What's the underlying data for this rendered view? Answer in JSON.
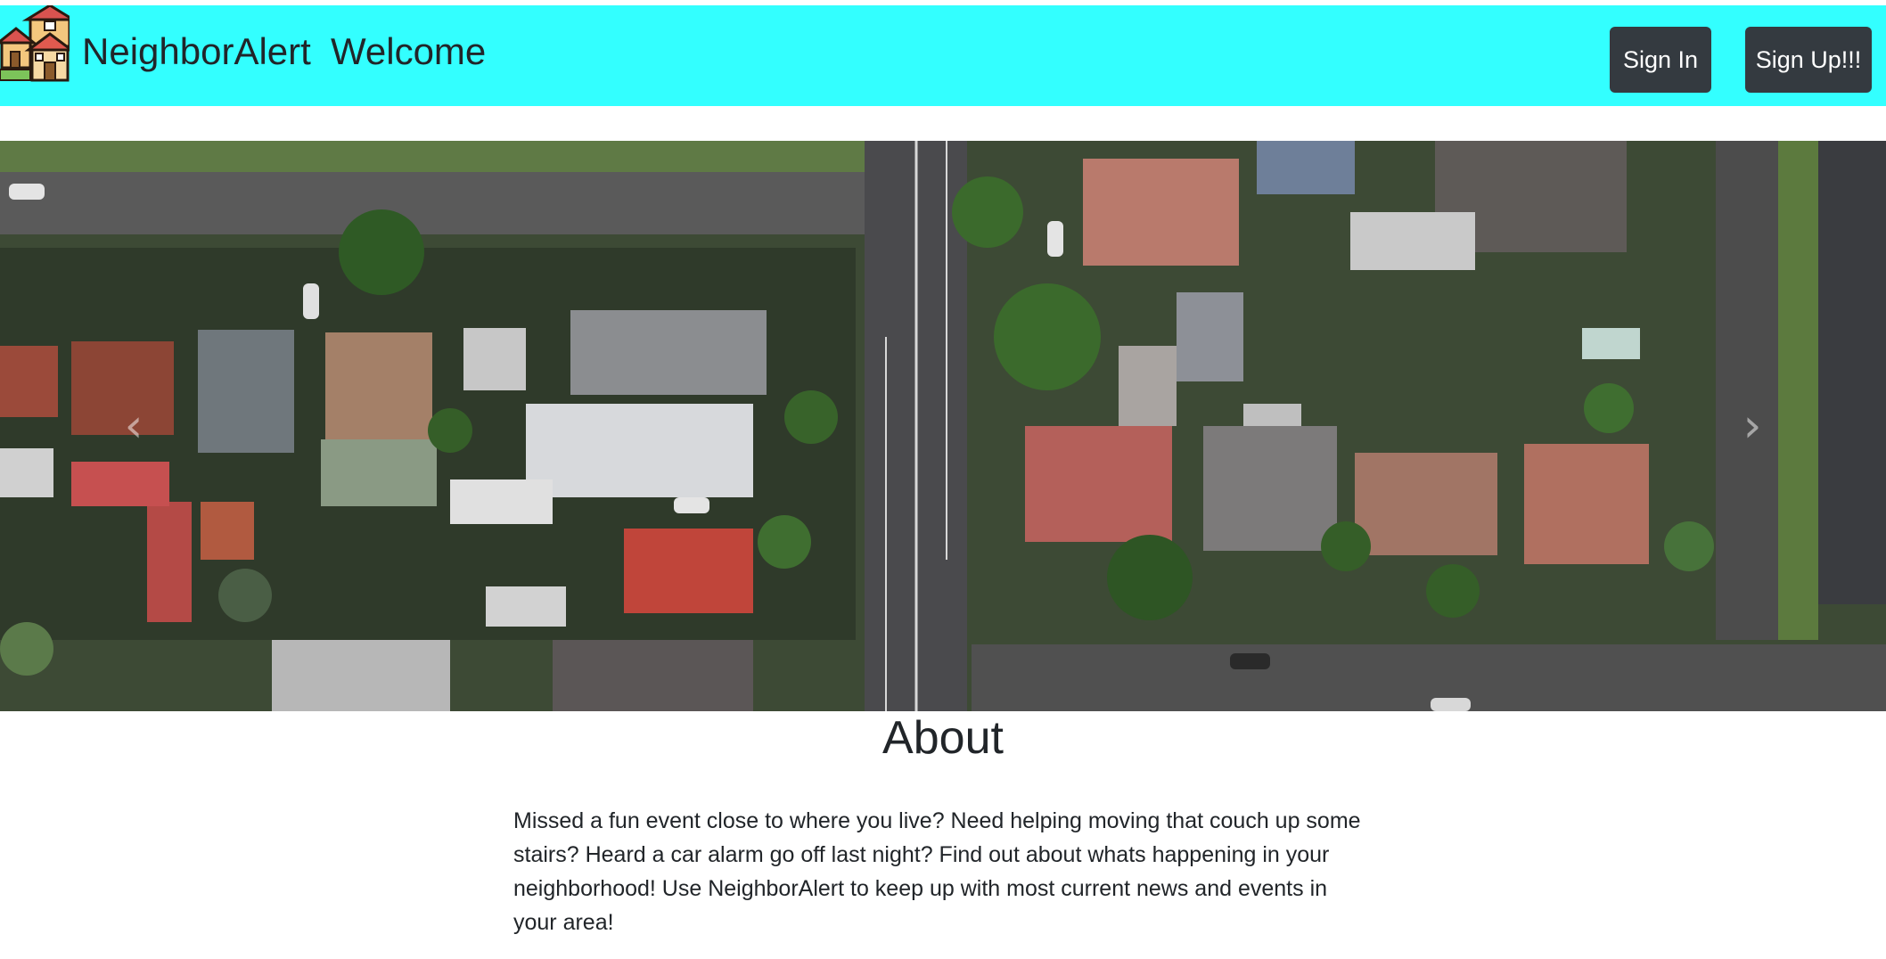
{
  "navbar": {
    "brand": "NeighborAlert",
    "welcome": "Welcome",
    "background_color": "#33ffff",
    "sign_in_label": "Sign In",
    "sign_up_label": "Sign Up!!!",
    "button_color": "#343a40",
    "logo_icon": "houses-icon"
  },
  "carousel": {
    "image": "aerial-neighborhood-photo",
    "prev_icon": "chevron-left-icon",
    "next_icon": "chevron-right-icon",
    "prev_glyph": "‹",
    "next_glyph": "›"
  },
  "about": {
    "title": "About",
    "body": "Missed a fun event close to where you live? Need helping moving that couch up some stairs? Heard a car alarm go off last night? Find out about whats happening in your neighborhood! Use NeighborAlert to keep up with most current news and events in your area!"
  }
}
